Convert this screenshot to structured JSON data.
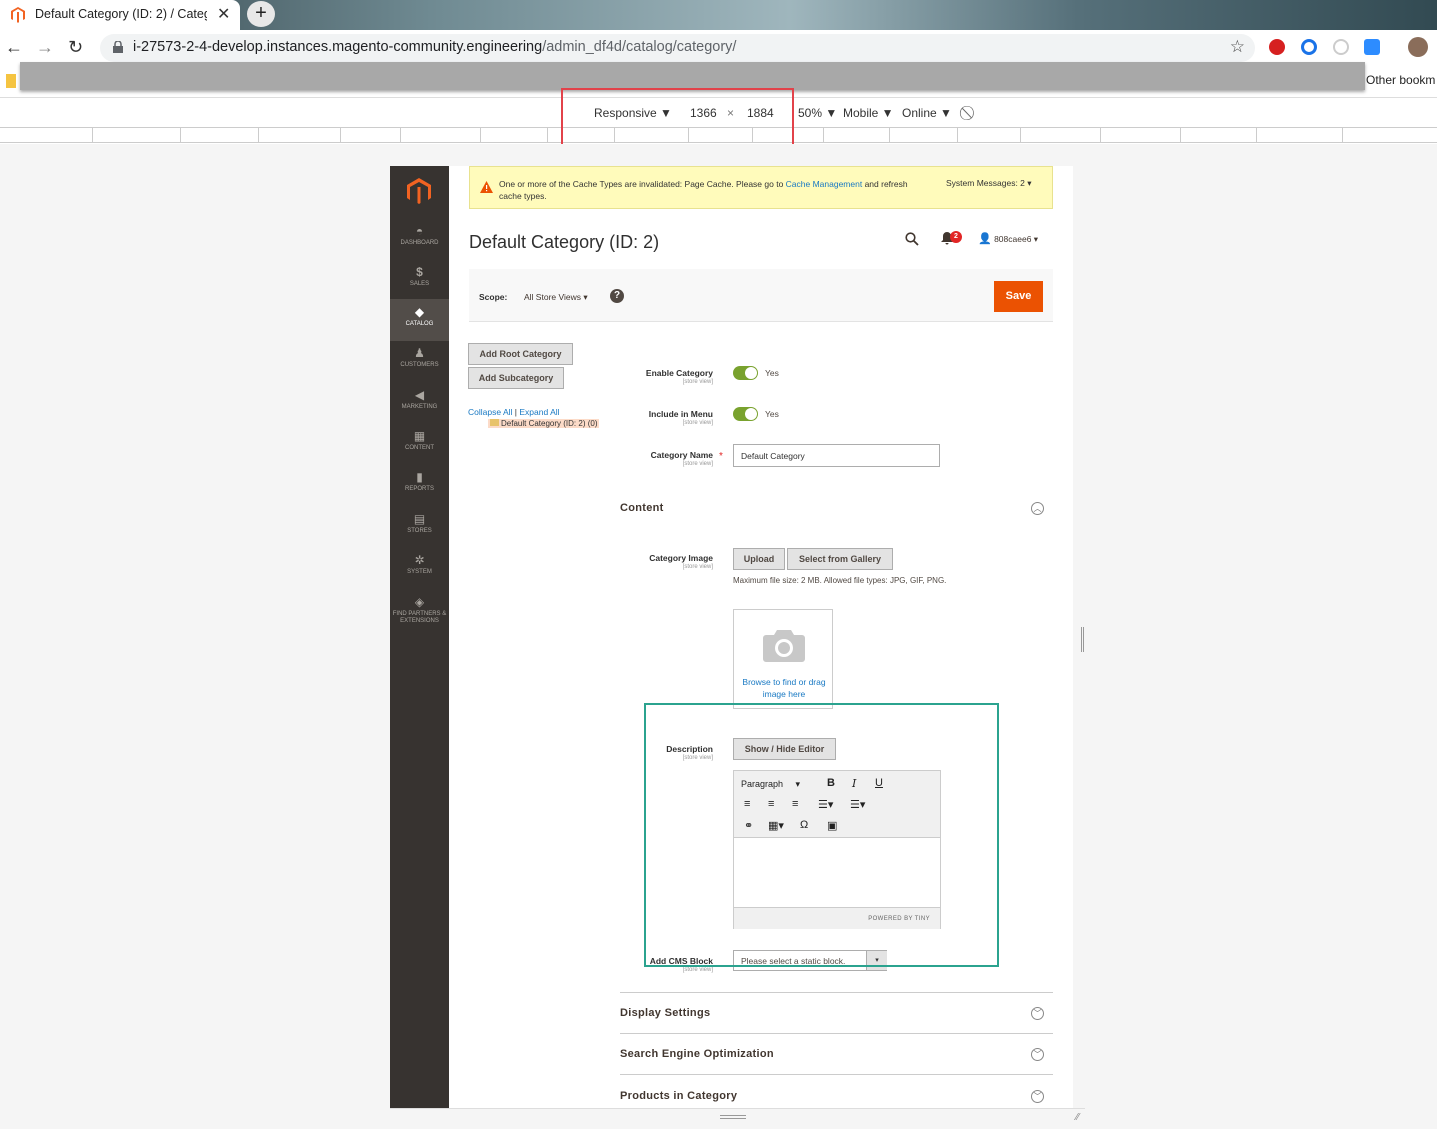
{
  "browser": {
    "tab_title": "Default Category (ID: 2) / Catego",
    "tab_close": "✕",
    "new_tab": "+",
    "url_host": "i-27573-2-4-develop.instances.magento-community.engineering",
    "url_path": "/admin_df4d/catalog/category/",
    "other_bookmarks": "Other bookm"
  },
  "devtools": {
    "device": "Responsive ▼",
    "width": "1366",
    "times": "×",
    "height": "1884",
    "zoom": "50% ▼",
    "mode": "Mobile ▼",
    "network": "Online ▼"
  },
  "sidebar": {
    "items": [
      {
        "label": "DASHBOARD",
        "icon": "dashboard-icon"
      },
      {
        "label": "SALES",
        "icon": "dollar-icon"
      },
      {
        "label": "CATALOG",
        "icon": "cube-icon"
      },
      {
        "label": "CUSTOMERS",
        "icon": "person-icon"
      },
      {
        "label": "MARKETING",
        "icon": "megaphone-icon"
      },
      {
        "label": "CONTENT",
        "icon": "layout-icon"
      },
      {
        "label": "REPORTS",
        "icon": "bar-chart-icon"
      },
      {
        "label": "STORES",
        "icon": "store-icon"
      },
      {
        "label": "SYSTEM",
        "icon": "gear-icon"
      },
      {
        "label": "FIND PARTNERS & EXTENSIONS",
        "icon": "box-icon"
      }
    ]
  },
  "message": {
    "text_before": "One or more of the Cache Types are invalidated: Page Cache. Please go to ",
    "link": "Cache Management",
    "text_after": " and refresh cache types.",
    "system": "System Messages: 2"
  },
  "header": {
    "title": "Default Category (ID: 2)",
    "notifications": "2",
    "user": "808caee6"
  },
  "scope": {
    "label": "Scope:",
    "value": "All Store Views",
    "help": "?",
    "save": "Save"
  },
  "tree": {
    "add_root": "Add Root Category",
    "add_sub": "Add Subcategory",
    "collapse": "Collapse All",
    "sep": "|",
    "expand": "Expand All",
    "node": "Default Category (ID: 2) (0)"
  },
  "form": {
    "store_view": "[store view]",
    "enable_label": "Enable Category",
    "enable_value": "Yes",
    "menu_label": "Include in Menu",
    "menu_value": "Yes",
    "name_label": "Category Name",
    "name_value": "Default Category",
    "required": "*"
  },
  "content": {
    "section": "Content",
    "image_label": "Category Image",
    "upload": "Upload",
    "gallery": "Select from Gallery",
    "image_note": "Maximum file size: 2 MB. Allowed file types: JPG, GIF, PNG.",
    "drop_text": "Browse to find or drag image here",
    "desc_label": "Description",
    "show_hide": "Show / Hide Editor",
    "paragraph": "Paragraph",
    "powered": "POWERED BY TINY",
    "cms_label": "Add CMS Block",
    "cms_placeholder": "Please select a static block."
  },
  "sections": {
    "display": "Display Settings",
    "seo": "Search Engine Optimization",
    "products": "Products in Category"
  },
  "colors": {
    "accent": "#eb5202",
    "sidebar": "#373330",
    "link": "#1979c3",
    "toggle": "#79a22e",
    "highlight_red": "#e2424a",
    "highlight_green": "#2ba38f"
  }
}
